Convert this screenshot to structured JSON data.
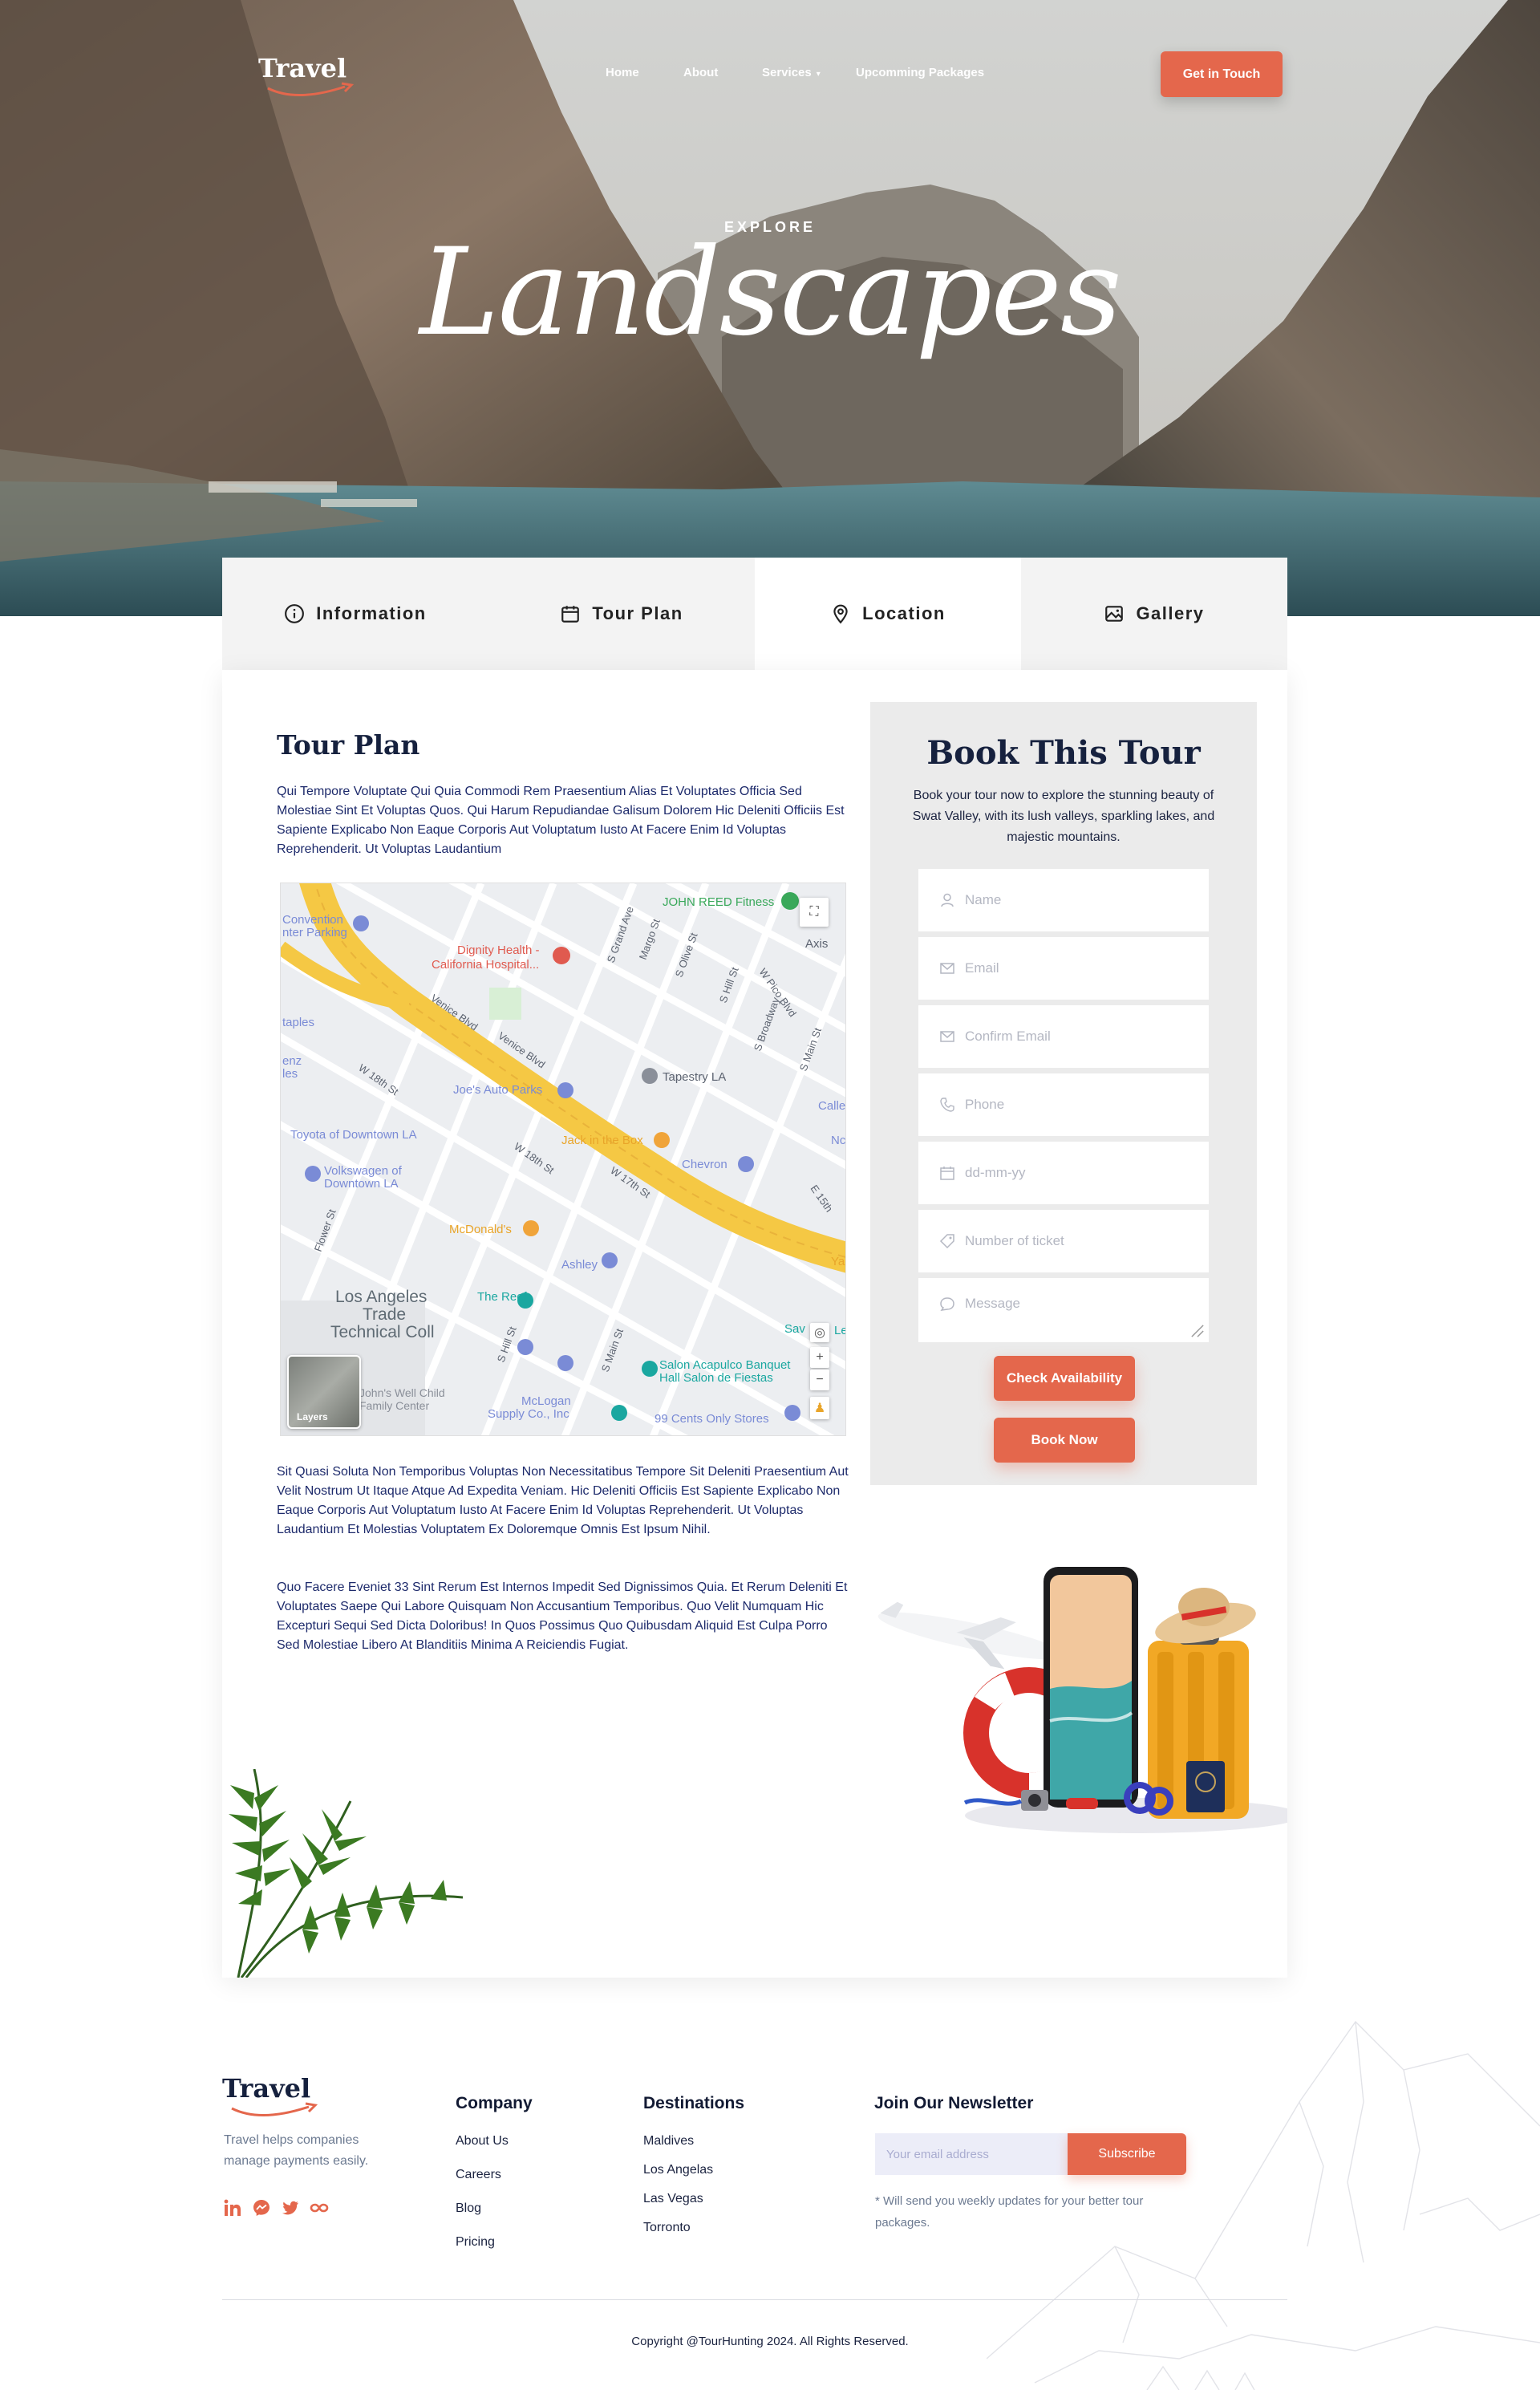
{
  "brand": {
    "logo_text": "Travel",
    "accent": "#e4674c",
    "navy": "#16213e"
  },
  "nav": {
    "items": [
      "Home",
      "About",
      "Services",
      "Upcomming Packages"
    ],
    "cta": "Get in Touch"
  },
  "hero": {
    "eyebrow": "EXPLORE",
    "title": "Landscapes"
  },
  "tabs": [
    {
      "label": "Information",
      "icon": "info-icon"
    },
    {
      "label": "Tour Plan",
      "icon": "calendar-icon"
    },
    {
      "label": "Location",
      "icon": "location-pin-icon",
      "active": true
    },
    {
      "label": "Gallery",
      "icon": "image-icon"
    }
  ],
  "content": {
    "title": "Tour Plan",
    "paragraphs": [
      "Qui Tempore Voluptate Qui Quia Commodi Rem Praesentium Alias Et Voluptates Officia Sed Molestiae Sint Et Voluptas Quos. Qui Harum Repudiandae Galisum Dolorem Hic Deleniti Officiis Est Sapiente Explicabo Non Eaque Corporis Aut Voluptatum Iusto At Facere Enim Id Voluptas Reprehenderit. Ut Voluptas Laudantium",
      "Sit Quasi Soluta Non Temporibus Voluptas Non Necessitatibus Tempore Sit Deleniti Praesentium Aut Velit Nostrum Ut Itaque Atque Ad Expedita Veniam. Hic Deleniti Officiis Est Sapiente Explicabo Non Eaque Corporis Aut Voluptatum Iusto At Facere Enim Id Voluptas Reprehenderit. Ut Voluptas Laudantium Et Molestias Voluptatem Ex Doloremque Omnis Est Ipsum Nihil.",
      "Quo Facere Eveniet 33 Sint Rerum Est Internos Impedit Sed Dignissimos Quia. Et Rerum Deleniti Et Voluptates Saepe Qui Labore Quisquam Non Accusantium Temporibus. Quo Velit Numquam Hic Excepturi Sequi Sed Dicta Doloribus! In Quos Possimus Quo Quibusdam Aliquid Est Culpa Porro Sed Molestiae Libero At Blanditiis Minima A Reiciendis Fugiat."
    ]
  },
  "map": {
    "labels": {
      "convention": "Convention",
      "parking": "nter Parking",
      "dignity": "Dignity Health -",
      "california": "California Hospital...",
      "reed": "JOHN REED Fitness",
      "axis": "Axis",
      "grand": "S Grand Ave",
      "margo": "Margo St",
      "olive": "S Olive St",
      "hill": "S Hill St",
      "pico": "W Pico Blvd",
      "broadway": "S Broadway",
      "main": "S Main St",
      "venice1": "Venice Blvd",
      "venice2": "Venice Blvd",
      "taples": "taples",
      "enz": "enz",
      "les": "les",
      "w18": "W 18th St",
      "joes": "Joe's Auto Parks",
      "tapestry": "Tapestry LA",
      "calle": "Calle",
      "toyota": "Toyota of Downtown LA",
      "jack": "Jack in the Box",
      "nc": "Nc",
      "volks1": "Volkswagen of",
      "volks2": "Downtown LA",
      "w18b": "W 18th St",
      "w17": "W 17th St",
      "chevron": "Chevron",
      "e15": "E 15th",
      "flower": "Flower St",
      "mcd": "McDonald's",
      "ya": "Ya",
      "ashley": "Ashley",
      "la1": "Los Angeles",
      "la2": "Trade",
      "la3": "Technical Coll",
      "reef": "The Reef",
      "sav": "Sav",
      "le": "Le",
      "shill2": "S Hill St",
      "smain2": "S Main St",
      "salon1": "Salon Acapulco Banquet",
      "salon2": "Hall Salon de Fiestas",
      "well1": "John's Well Child",
      "well2": "Family Center",
      "mclogan1": "McLogan",
      "mclogan2": "Supply Co., Inc",
      "cents": "99 Cents Only Stores",
      "layers": "Layers"
    }
  },
  "booking": {
    "title": "Book This Tour",
    "description": "Book your tour now to explore the stunning beauty of Swat Valley, with its lush valleys, sparkling lakes, and majestic mountains.",
    "fields": {
      "name": "Name",
      "email": "Email",
      "confirm_email": "Confirm Email",
      "phone": "Phone",
      "date": "dd-mm-yy",
      "tickets": "Number of ticket",
      "message": "Message"
    },
    "check_btn": "Check Availability",
    "book_btn": "Book Now"
  },
  "footer": {
    "logo_text": "Travel",
    "tagline": "Travel helps companies manage payments easily.",
    "company": {
      "title": "Company",
      "links": [
        "About Us",
        "Careers",
        "Blog",
        "Pricing"
      ]
    },
    "destinations": {
      "title": "Destinations",
      "links": [
        "Maldives",
        "Los Angelas",
        "Las Vegas",
        "Torronto"
      ]
    },
    "newsletter": {
      "title": "Join Our Newsletter",
      "placeholder": "Your email address",
      "button": "Subscribe",
      "note": "* Will send you weekly updates for your better tour packages."
    },
    "copyright": "Copyright @TourHunting 2024. All Rights Reserved."
  }
}
